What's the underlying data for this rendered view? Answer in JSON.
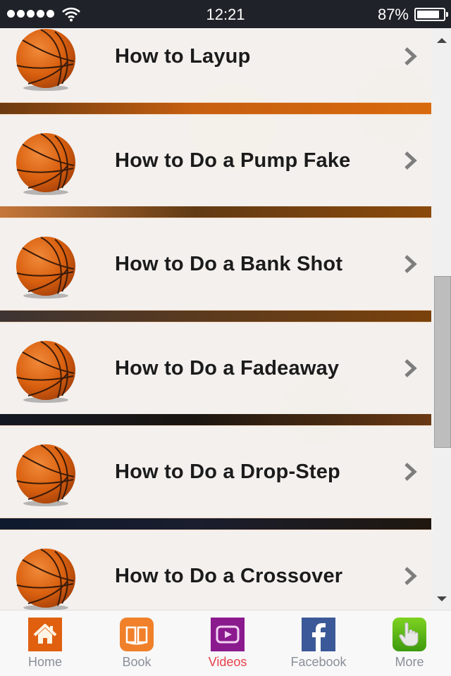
{
  "status_bar": {
    "time": "12:21",
    "battery_percent": "87%",
    "battery_level": 0.87,
    "signal_bars": 5
  },
  "list": {
    "items": [
      {
        "label": "How to Layup"
      },
      {
        "label": "How to Do a Pump Fake"
      },
      {
        "label": "How to Do a Bank Shot"
      },
      {
        "label": "How to Do a Fadeaway"
      },
      {
        "label": "How to Do a Drop-Step"
      },
      {
        "label": "How to Do a Crossover"
      }
    ],
    "separators": [
      {
        "from": "#6b3a10",
        "mid": "#c65f10",
        "to": "#d96a0e"
      },
      {
        "from": "#c5773a",
        "mid": "#613a14",
        "to": "#8b4a0c"
      },
      {
        "from": "#3d3433",
        "mid": "#5a3a1e",
        "to": "#7a420c"
      },
      {
        "from": "#141822",
        "mid": "#1a1510",
        "to": "#6a3a14"
      },
      {
        "from": "#0f1a2e",
        "mid": "#1a1e2e",
        "to": "#1f170f"
      }
    ]
  },
  "scrollbar": {
    "position_fraction": 0.56
  },
  "tabbar": {
    "tabs": [
      {
        "label": "Home",
        "icon": "home-icon",
        "color": "#e06010",
        "active": false
      },
      {
        "label": "Book",
        "icon": "book-icon",
        "color": "#f0802a",
        "active": false
      },
      {
        "label": "Videos",
        "icon": "video-icon",
        "color": "#8a1a8e",
        "active": true
      },
      {
        "label": "Facebook",
        "icon": "facebook-icon",
        "color": "#3b5998",
        "active": false
      },
      {
        "label": "More",
        "icon": "hand-pointer-icon",
        "color": "#5cb818",
        "active": false
      }
    ]
  }
}
